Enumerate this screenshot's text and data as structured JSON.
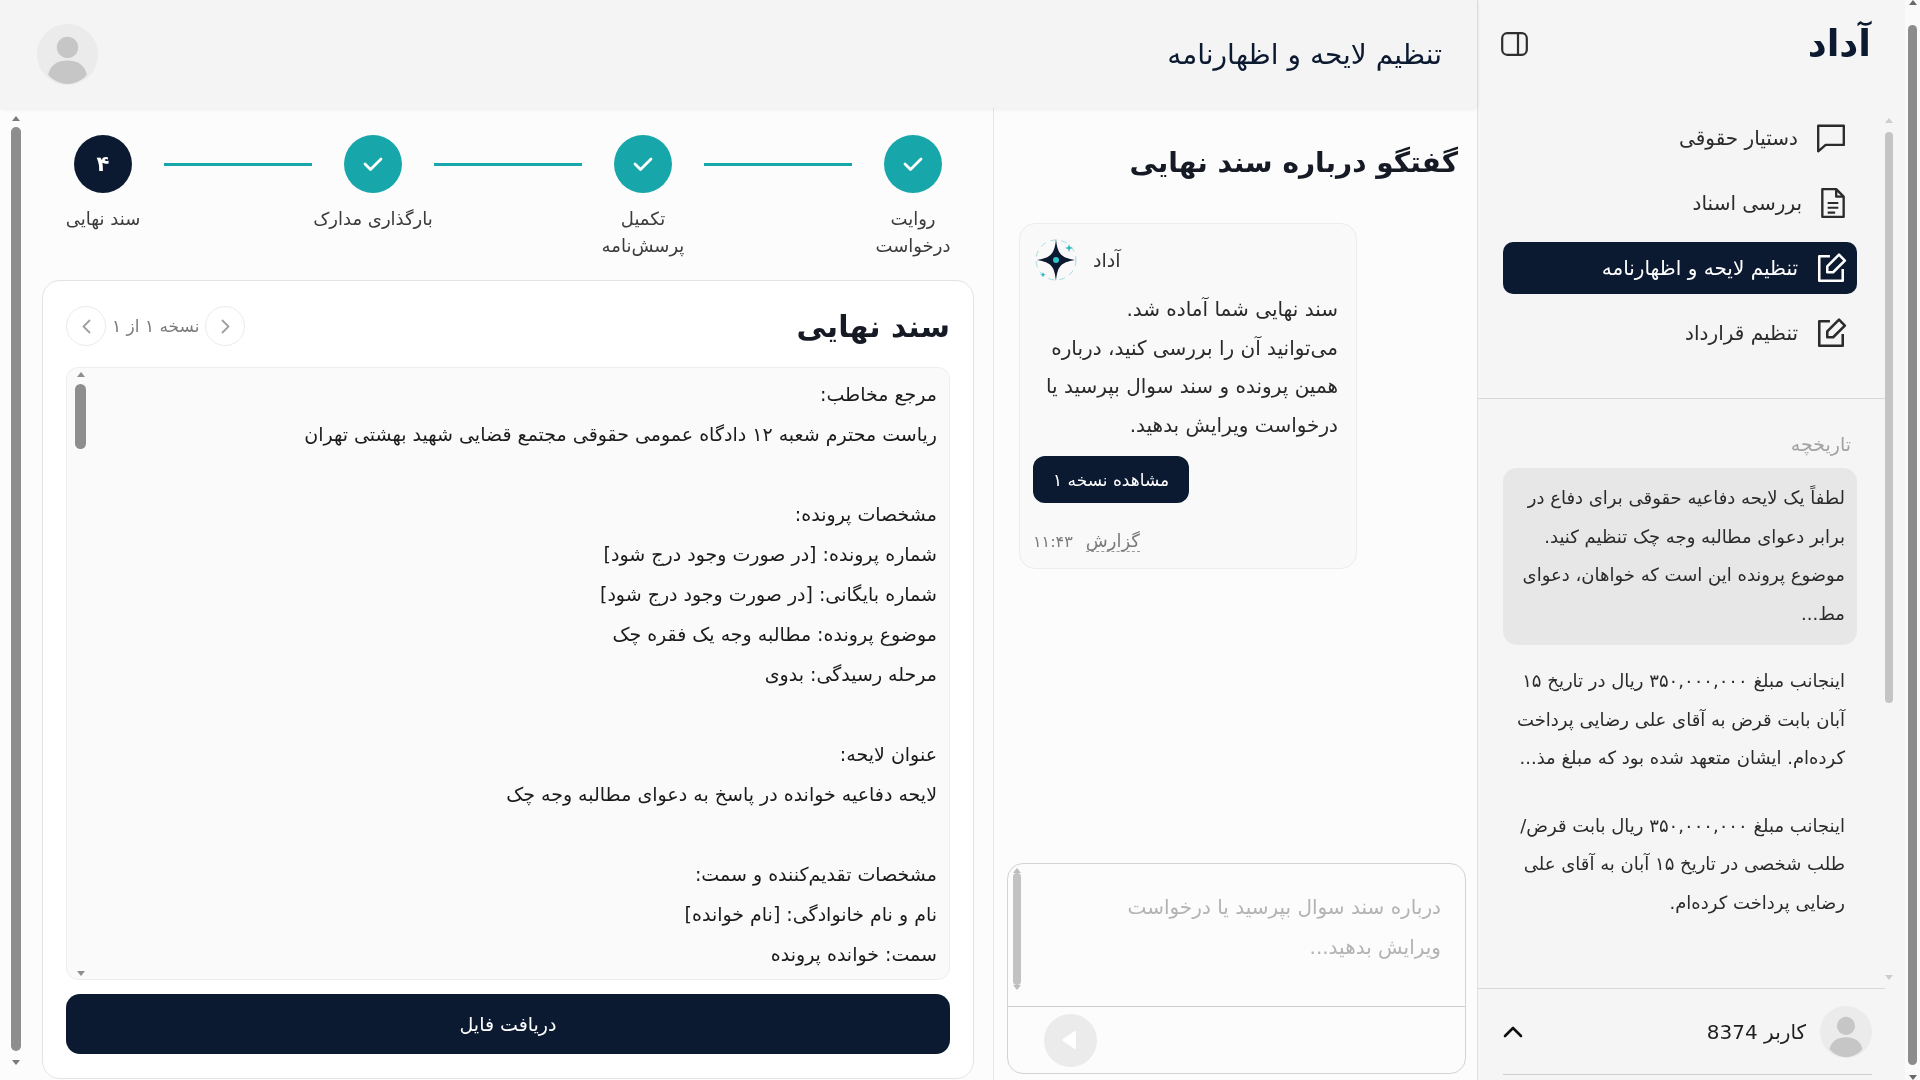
{
  "sidebar": {
    "logo": "آداد",
    "nav_items": [
      {
        "label": "دستیار حقوقی",
        "selected": false
      },
      {
        "label": "بررسی اسناد",
        "selected": false
      },
      {
        "label": "تنظیم لایحه و اظهارنامه",
        "selected": true
      },
      {
        "label": "تنظیم قرارداد",
        "selected": false
      }
    ],
    "history_heading": "تاریخچه",
    "history": [
      {
        "text": "لطفاً یک لایحه دفاعیه حقوقی برای دفاع در برابر دعوای مطالبه وجه چک تنظیم کنید. موضوع پرونده این است که خواهان، دعوای مط...",
        "selected": true
      },
      {
        "text": "اینجانب مبلغ ۳۵۰,۰۰۰,۰۰۰ ریال در تاریخ ۱۵ آبان بابت قرض به آقای علی رضایی پرداخت کرده‌ام. ایشان متعهد شده بود که مبلغ مذ...",
        "selected": false
      },
      {
        "text": "اینجانب مبلغ ۳۵۰,۰۰۰,۰۰۰ ریال بابت قرض/طلب شخصی در تاریخ ۱۵ آبان به آقای علی رضایی پرداخت کرده‌ام.",
        "selected": false
      }
    ],
    "user": {
      "name": "کاربر 8374"
    }
  },
  "header": {
    "title": "تنظیم لایحه و اظهارنامه"
  },
  "stepper": {
    "steps": [
      {
        "label": "روایت\nدرخواست",
        "completed": true
      },
      {
        "label": "تکمیل\nپرسش‌نامه",
        "completed": true
      },
      {
        "label": "بارگذاری مدارک",
        "completed": true
      },
      {
        "label": "سند نهایی",
        "completed": false,
        "number": "۴"
      }
    ]
  },
  "document": {
    "title": "سند نهایی",
    "version": "نسخه ۱ از ۱",
    "sections": [
      {
        "heading": "مرجع مخاطب:",
        "lines": [
          "ریاست محترم شعبه ۱۲ دادگاه عمومی حقوقی مجتمع قضایی شهید بهشتی تهران"
        ]
      },
      {
        "heading": "مشخصات پرونده:",
        "lines": [
          "شماره پرونده: [در صورت وجود درج شود]",
          "شماره بایگانی: [در صورت وجود درج شود]",
          "موضوع پرونده: مطالبه وجه یک فقره چک",
          "مرحله رسیدگی: بدوی"
        ]
      },
      {
        "heading": "عنوان لایحه:",
        "lines": [
          "لایحه دفاعیه خوانده در پاسخ به دعوای مطالبه وجه چک"
        ]
      },
      {
        "heading": "مشخصات تقدیم‌کننده و سمت:",
        "lines": [
          "نام و نام خانوادگی: [نام خوانده]",
          "سمت: خوانده پرونده"
        ]
      }
    ],
    "download_button": "دریافت فایل"
  },
  "chat": {
    "title": "گفتگو درباره سند نهایی",
    "messages": [
      {
        "sender": "آداد",
        "text": "سند نهایی شما آماده شد.\nمی‌توانید آن را بررسی کنید، درباره همین پرونده و سند سوال بپرسید یا درخواست ویرایش بدهید.",
        "button": "مشاهده نسخه ۱",
        "report_link": "گزارش",
        "time": "۱۱:۴۳"
      }
    ],
    "input": {
      "placeholder": "درباره سند سوال بپرسید یا درخواست ویرایش بدهید..."
    }
  }
}
